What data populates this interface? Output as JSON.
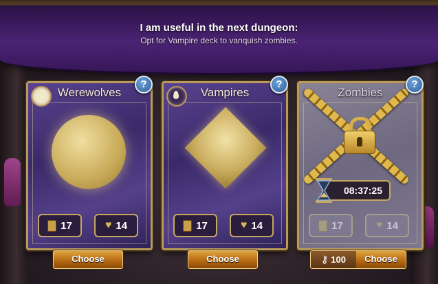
{
  "banner": {
    "title": "I am useful in the next dungeon:",
    "subtitle": "Opt for Vampire deck to vanquish zombies."
  },
  "decks": [
    {
      "name": "Werewolves",
      "cards": "17",
      "health": "14",
      "button": "Choose",
      "emblem": "moon-icon",
      "locked": false
    },
    {
      "name": "Vampires",
      "cards": "17",
      "health": "14",
      "button": "Choose",
      "emblem": "drop-icon",
      "locked": false
    },
    {
      "name": "Zombies",
      "cards": "17",
      "health": "14",
      "button": "Choose",
      "emblem": "padlock-icon",
      "locked": true,
      "timer": "08:37:25",
      "unlock_cost": "100"
    }
  ],
  "help_label": "?",
  "colors": {
    "accent": "#c7a860",
    "button": "#b86a12",
    "drape": "#4b2374"
  }
}
